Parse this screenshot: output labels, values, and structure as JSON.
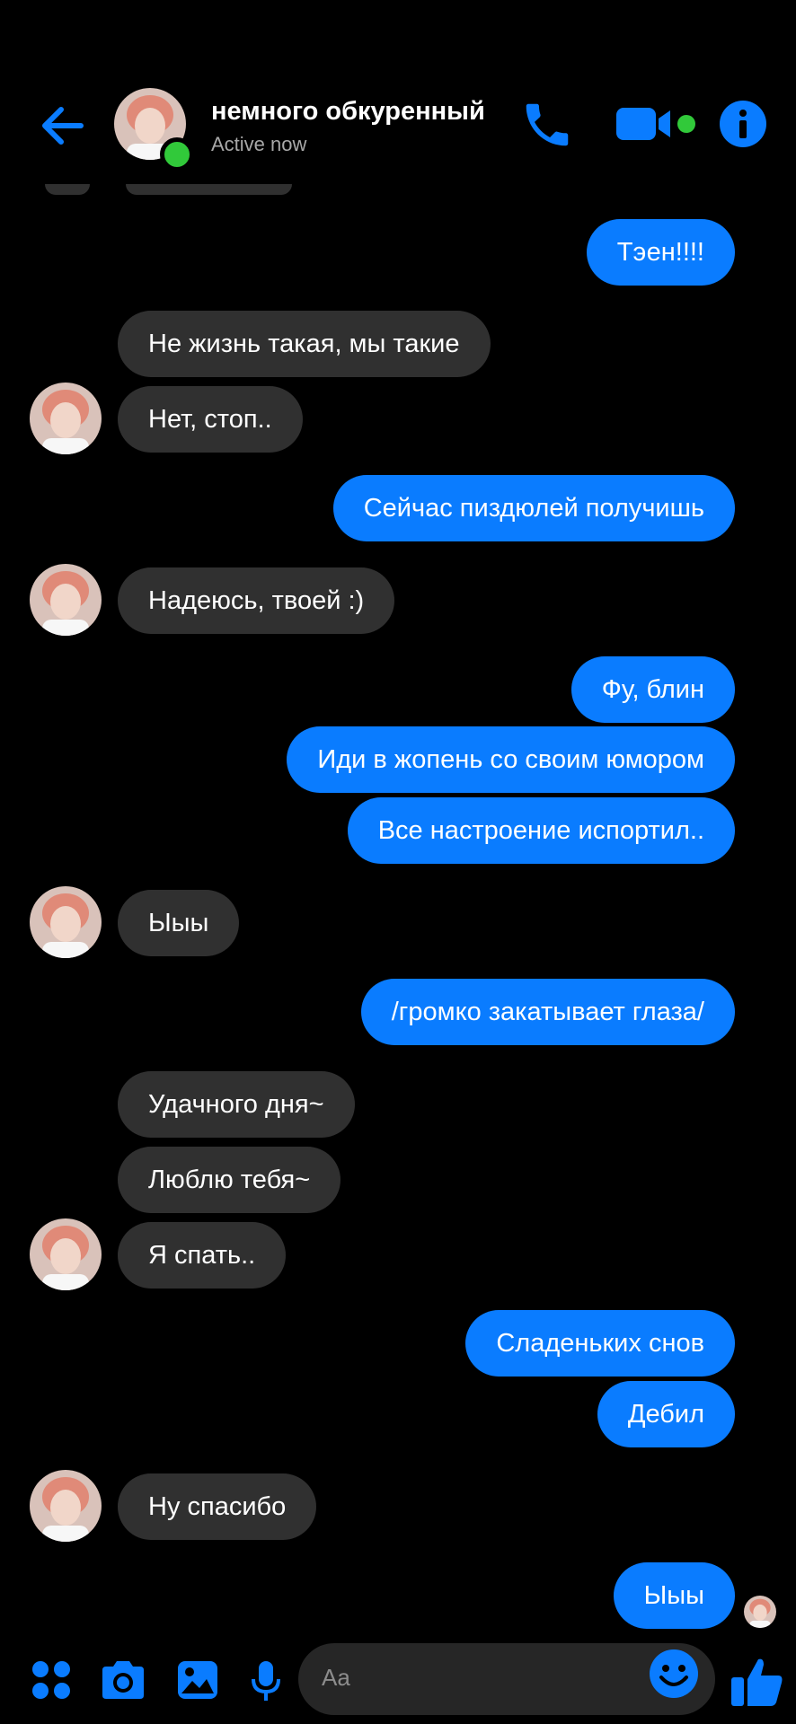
{
  "header": {
    "title": "немного обкуренный",
    "status": "Active now",
    "back_icon": "back-arrow-icon",
    "call_icon": "phone-icon",
    "video_icon": "video-camera-icon",
    "info_icon": "info-icon"
  },
  "colors": {
    "accent": "#0a7cff",
    "incoming_bubble": "#303030",
    "online": "#31c93a",
    "background": "#000000"
  },
  "messages": [
    {
      "dir": "out",
      "text": "Тэен!!!!"
    },
    {
      "dir": "in",
      "text": "Не жизнь такая, мы такие"
    },
    {
      "dir": "in",
      "text": "Нет, стоп.."
    },
    {
      "dir": "out",
      "text": "Сейчас пиздюлей получишь"
    },
    {
      "dir": "in",
      "text": "Надеюсь, твоей :)"
    },
    {
      "dir": "out",
      "text": "Фу, блин"
    },
    {
      "dir": "out",
      "text": "Иди в жопень со своим юмором"
    },
    {
      "dir": "out",
      "text": "Все настроение испортил.."
    },
    {
      "dir": "in",
      "text": "Ыыы"
    },
    {
      "dir": "out",
      "text": "/громко закатывает глаза/"
    },
    {
      "dir": "in",
      "text": "Удачного дня~"
    },
    {
      "dir": "in",
      "text": "Люблю тебя~"
    },
    {
      "dir": "in",
      "text": "Я спать.."
    },
    {
      "dir": "out",
      "text": "Сладеньких снов"
    },
    {
      "dir": "out",
      "text": "Дебил"
    },
    {
      "dir": "in",
      "text": "Ну спасибо"
    },
    {
      "dir": "out",
      "text": "Ыыы"
    }
  ],
  "composer": {
    "placeholder": "Aa",
    "icons": [
      "apps-grid-icon",
      "camera-icon",
      "gallery-icon",
      "microphone-icon",
      "emoji-icon",
      "thumbs-up-icon"
    ]
  }
}
